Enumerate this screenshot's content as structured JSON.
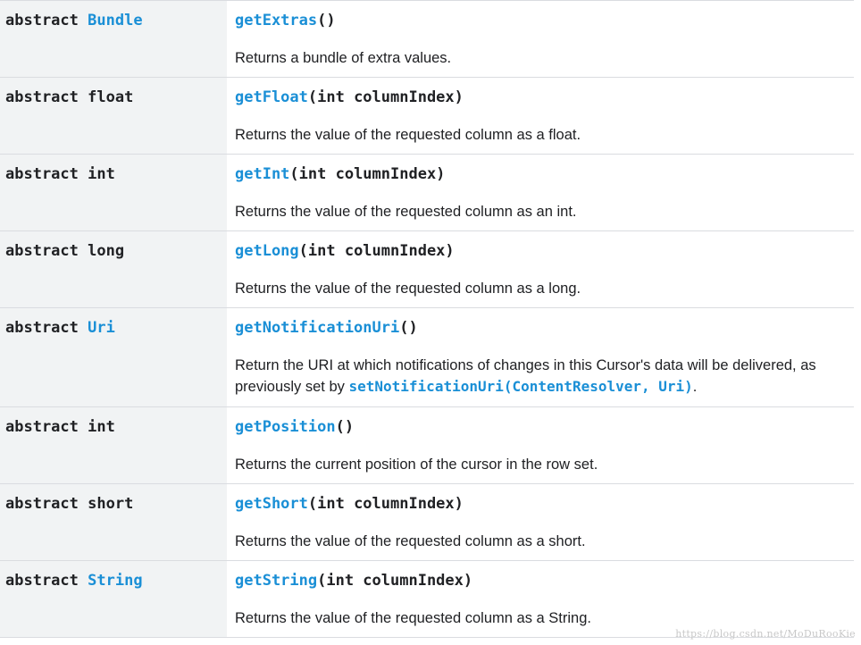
{
  "rows": [
    {
      "modifier": "abstract",
      "return_type": "Bundle",
      "return_is_link": true,
      "method": "getExtras",
      "params": "()",
      "description": "Returns a bundle of extra values."
    },
    {
      "modifier": "abstract",
      "return_type": "float",
      "return_is_link": false,
      "method": "getFloat",
      "params": "(int columnIndex)",
      "description": "Returns the value of the requested column as a float."
    },
    {
      "modifier": "abstract",
      "return_type": "int",
      "return_is_link": false,
      "method": "getInt",
      "params": "(int columnIndex)",
      "description": "Returns the value of the requested column as an int."
    },
    {
      "modifier": "abstract",
      "return_type": "long",
      "return_is_link": false,
      "method": "getLong",
      "params": "(int columnIndex)",
      "description": "Returns the value of the requested column as a long."
    },
    {
      "modifier": "abstract",
      "return_type": "Uri",
      "return_is_link": true,
      "method": "getNotificationUri",
      "params": "()",
      "description_before": "Return the URI at which notifications of changes in this Cursor's data will be delivered, as previously set by ",
      "description_link": "setNotificationUri(ContentResolver, Uri)",
      "description_after": "."
    },
    {
      "modifier": "abstract",
      "return_type": "int",
      "return_is_link": false,
      "method": "getPosition",
      "params": "()",
      "description": "Returns the current position of the cursor in the row set."
    },
    {
      "modifier": "abstract",
      "return_type": "short",
      "return_is_link": false,
      "method": "getShort",
      "params": "(int columnIndex)",
      "description": "Returns the value of the requested column as a short."
    },
    {
      "modifier": "abstract",
      "return_type": "String",
      "return_is_link": true,
      "method": "getString",
      "params": "(int columnIndex)",
      "description": "Returns the value of the requested column as a String."
    }
  ],
  "watermark": "https://blog.csdn.net/MoDuRooKie",
  "colors": {
    "link": "#1a8fd6",
    "text": "#202124",
    "type_column_bg": "#f1f3f4",
    "border": "#dadce0"
  }
}
